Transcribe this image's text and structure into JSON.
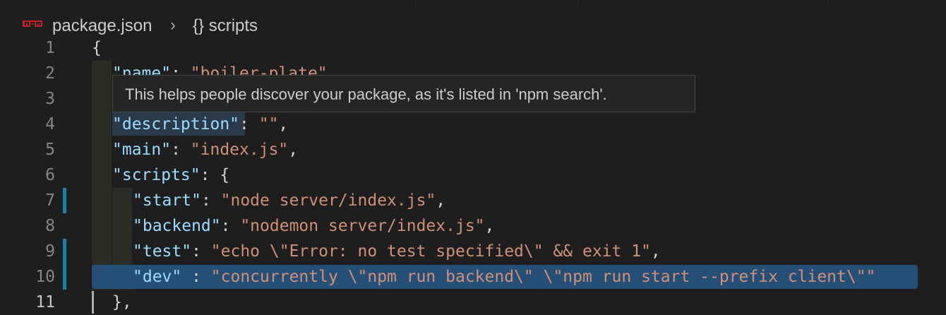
{
  "breadcrumb": {
    "file": "package.json",
    "separator": "›",
    "symbol": "{} scripts",
    "icon": "npm-icon"
  },
  "tooltip": {
    "text": "This helps people discover your package, as it's listed in 'npm search'."
  },
  "lines": [
    {
      "num": "1"
    },
    {
      "num": "2"
    },
    {
      "num": "3"
    },
    {
      "num": "4"
    },
    {
      "num": "5"
    },
    {
      "num": "6"
    },
    {
      "num": "7"
    },
    {
      "num": "8"
    },
    {
      "num": "9"
    },
    {
      "num": "10"
    },
    {
      "num": "11"
    }
  ],
  "code": {
    "l1": "{",
    "l2_key": "\"name\"",
    "l2_colon": ": ",
    "l2_val": "\"boiler-plate\"",
    "l4_key": "\"description\"",
    "l4_colon": ": ",
    "l4_val": "\"\"",
    "l4_comma": ",",
    "l5_key": "\"main\"",
    "l5_colon": ": ",
    "l5_val": "\"index.js\"",
    "l5_comma": ",",
    "l6_key": "\"scripts\"",
    "l6_rest": ": {",
    "l7_key": "\"start\"",
    "l7_colon": ": ",
    "l7_val": "\"node server/index.js\"",
    "l7_comma": ",",
    "l8_key": "\"backend\"",
    "l8_colon": ": ",
    "l8_val": "\"nodemon server/index.js\"",
    "l8_comma": ",",
    "l9_key": "\"test\"",
    "l9_colon": ": ",
    "l9_val": "\"echo \\\"Error: no test specified\\\" && exit 1\"",
    "l9_comma": ",",
    "l10_key": "\"dev\"",
    "l10_colon": " : ",
    "l10_val": "\"concurrently \\\"npm run backend\\\" \\\"npm run start --prefix client\\\"\"",
    "l11": "},"
  },
  "colors": {
    "background": "#1e1e1e",
    "key": "#9cdcfe",
    "string": "#ce9178",
    "selection": "#264f78",
    "modified_gutter": "#1b81a8"
  }
}
